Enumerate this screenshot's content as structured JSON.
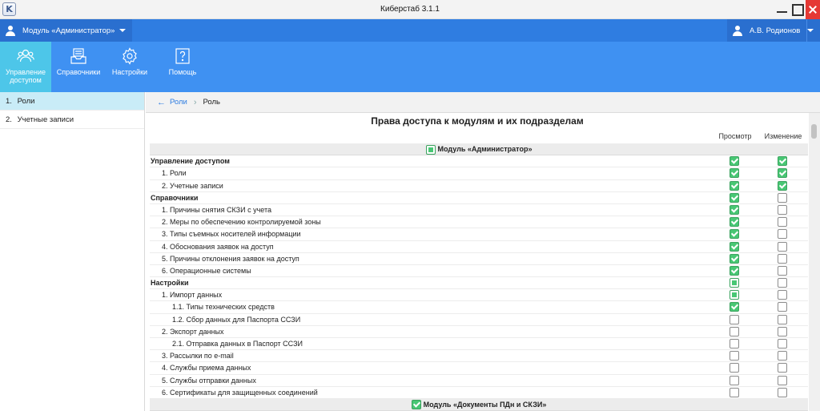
{
  "window": {
    "title": "Киберстаб 3.1.1",
    "logo_letter": "K"
  },
  "modulebar": {
    "module_label": "Модуль «Администратор»",
    "user_name": "А.В. Родионов"
  },
  "toolbar": {
    "items": [
      {
        "label": "Управление доступом",
        "icon": "users-icon",
        "active": true
      },
      {
        "label": "Справочники",
        "icon": "inbox-icon",
        "active": false
      },
      {
        "label": "Настройки",
        "icon": "gear-icon",
        "active": false
      },
      {
        "label": "Помощь",
        "icon": "help-icon",
        "active": false
      }
    ]
  },
  "sidebar": {
    "items": [
      {
        "num": "1.",
        "label": "Роли",
        "active": true
      },
      {
        "num": "2.",
        "label": "Учетные записи",
        "active": false
      }
    ]
  },
  "breadcrumb": {
    "back_label": "Роли",
    "current": "Роль"
  },
  "page": {
    "title": "Права доступа к модулям и их подразделам",
    "col_view": "Просмотр",
    "col_edit": "Изменение"
  },
  "rows": [
    {
      "type": "module",
      "label": "Модуль «Администратор»",
      "view": "partial"
    },
    {
      "type": "section",
      "label": "Управление доступом",
      "view": "on",
      "edit": "on"
    },
    {
      "type": "lvl1",
      "label": "1. Роли",
      "view": "on",
      "edit": "on"
    },
    {
      "type": "lvl1",
      "label": "2. Учетные записи",
      "view": "on",
      "edit": "on"
    },
    {
      "type": "section",
      "label": "Справочники",
      "view": "on",
      "edit": "off"
    },
    {
      "type": "lvl1",
      "label": "1. Причины снятия СКЗИ с учета",
      "view": "on",
      "edit": "off"
    },
    {
      "type": "lvl1",
      "label": "2. Меры по обеспечению контролируемой зоны",
      "view": "on",
      "edit": "off"
    },
    {
      "type": "lvl1",
      "label": "3. Типы съемных носителей информации",
      "view": "on",
      "edit": "off"
    },
    {
      "type": "lvl1",
      "label": "4. Обоснования заявок на доступ",
      "view": "on",
      "edit": "off"
    },
    {
      "type": "lvl1",
      "label": "5. Причины отклонения заявок на доступ",
      "view": "on",
      "edit": "off"
    },
    {
      "type": "lvl1",
      "label": "6. Операционные системы",
      "view": "on",
      "edit": "off"
    },
    {
      "type": "section",
      "label": "Настройки",
      "view": "partial",
      "edit": "off"
    },
    {
      "type": "lvl1",
      "label": "1. Импорт данных",
      "view": "partial",
      "edit": "off"
    },
    {
      "type": "lvl2",
      "label": "1.1. Типы технических средств",
      "view": "on",
      "edit": "off"
    },
    {
      "type": "lvl2",
      "label": "1.2. Сбор данных для Паспорта ССЗИ",
      "view": "off",
      "edit": "off"
    },
    {
      "type": "lvl1",
      "label": "2. Экспорт данных",
      "view": "off",
      "edit": "off"
    },
    {
      "type": "lvl2",
      "label": "2.1. Отправка данных в Паспорт ССЗИ",
      "view": "off",
      "edit": "off"
    },
    {
      "type": "lvl1",
      "label": "3. Рассылки по e-mail",
      "view": "off",
      "edit": "off"
    },
    {
      "type": "lvl1",
      "label": "4. Службы приема данных",
      "view": "off",
      "edit": "off"
    },
    {
      "type": "lvl1",
      "label": "5. Службы отправки данных",
      "view": "off",
      "edit": "off"
    },
    {
      "type": "lvl1",
      "label": "6. Сертификаты для защищенных соединений",
      "view": "off",
      "edit": "off"
    },
    {
      "type": "module",
      "label": "Модуль «Документы ПДн и СКЗИ»",
      "view": "on"
    }
  ],
  "colors": {
    "accent": "#3f91f2",
    "active_tool": "#4dc6e9",
    "check_green": "#48c774"
  }
}
